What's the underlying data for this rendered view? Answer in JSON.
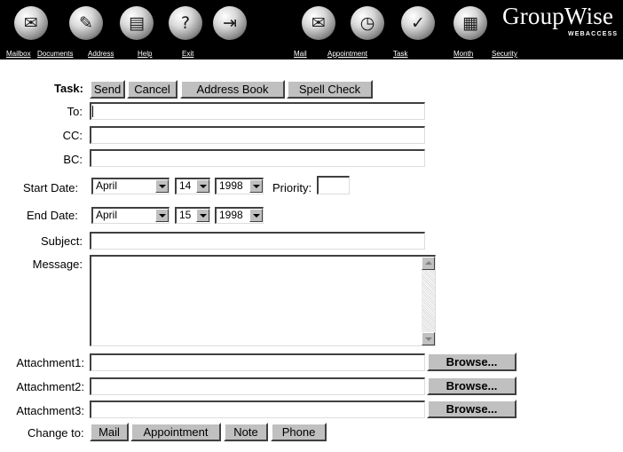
{
  "brand": {
    "name": "GroupWise",
    "sub": "WEBACCESS"
  },
  "toolbar_icons": [
    "mailbox-icon",
    "documents-icon",
    "address-book-icon",
    "help-icon",
    "exit-icon",
    "mail-icon",
    "appointment-icon",
    "task-icon",
    "month-calendar-icon"
  ],
  "nav": {
    "mailbox": "Mailbox",
    "documents": "Documents",
    "address": "Address",
    "help": "Help",
    "exit": "Exit",
    "mail": "Mail",
    "appointment": "Appointment",
    "task": "Task",
    "month": "Month",
    "security": "Security"
  },
  "form": {
    "task_label": "Task:",
    "send": "Send",
    "cancel": "Cancel",
    "address_book": "Address Book",
    "spell_check": "Spell Check",
    "to_label": "To:",
    "to_value": "",
    "cc_label": "CC:",
    "cc_value": "",
    "bc_label": "BC:",
    "bc_value": "",
    "start_label": "Start Date:",
    "start_month": "April",
    "start_day": "14",
    "start_year": "1998",
    "priority_label": "Priority:",
    "priority_value": "",
    "end_label": "End Date:",
    "end_month": "April",
    "end_day": "15",
    "end_year": "1998",
    "subject_label": "Subject:",
    "subject_value": "",
    "message_label": "Message:",
    "message_value": "",
    "attachment1_label": "Attachment1:",
    "attachment2_label": "Attachment2:",
    "attachment3_label": "Attachment3:",
    "browse": "Browse...",
    "change_to_label": "Change to:",
    "change_mail": "Mail",
    "change_appointment": "Appointment",
    "change_note": "Note",
    "change_phone": "Phone"
  }
}
